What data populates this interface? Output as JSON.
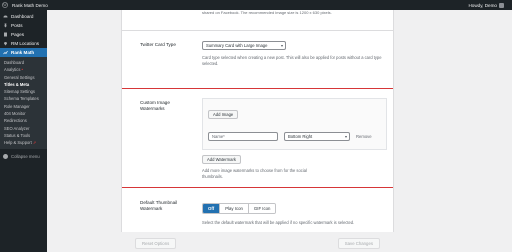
{
  "admin_bar": {
    "site_name": "Rank Math Demo",
    "howdy": "Howdy, Demo"
  },
  "sidebar": {
    "items_top": [
      {
        "label": "Dashboard",
        "icon": "dashboard-icon"
      },
      {
        "label": "Posts",
        "icon": "pin-icon"
      },
      {
        "label": "Pages",
        "icon": "page-icon"
      },
      {
        "label": "RM Locations",
        "icon": "location-icon"
      }
    ],
    "rank_math": {
      "label": "Rank Math",
      "icon": "rank-math-icon"
    },
    "submenu": [
      {
        "label": "Dashboard"
      },
      {
        "label": "Analytics",
        "badge": "•"
      },
      {
        "label": "General Settings"
      },
      {
        "label": "Titles & Meta"
      },
      {
        "label": "Sitemap Settings"
      },
      {
        "label": "Schema Templates"
      },
      {
        "label": "Role Manager"
      },
      {
        "label": "404 Monitor"
      },
      {
        "label": "Redirections"
      },
      {
        "label": "SEO Analyzer"
      },
      {
        "label": "Status & Tools"
      },
      {
        "label": "Help & Support",
        "badge": "⇗"
      }
    ],
    "collapse_label": "Collapse menu"
  },
  "content": {
    "top_description": "shared on Facebook. The recommended image size is 1200 x 630 pixels.",
    "twitter_card": {
      "label": "Twitter Card Type",
      "value": "Summary Card with Large Image",
      "description": "Card type selected when creating a new post. This will also be applied for posts without a card type selected."
    },
    "custom_watermarks": {
      "label": "Custom Image Watermarks",
      "add_image": "Add Image",
      "name_placeholder": "Name*",
      "position_value": "Bottom Right",
      "remove": "Remove",
      "add_watermark": "Add Watermark",
      "description": "Add more image watermarks to choose from for the social thumbnails."
    },
    "default_thumbnail": {
      "label": "Default Thumbnail Watermark",
      "options": [
        "Off",
        "Play Icon",
        "GIF Icon"
      ],
      "selected": "Off",
      "description": "Select the default watermark that will be applied if no specific watermark is selected."
    }
  },
  "footer": {
    "reset_label": "Reset Options",
    "save_label": "Save Changes"
  },
  "colors": {
    "admin_dark": "#1d2327",
    "accent_blue": "#2271b1",
    "highlight_red": "#d63638"
  }
}
